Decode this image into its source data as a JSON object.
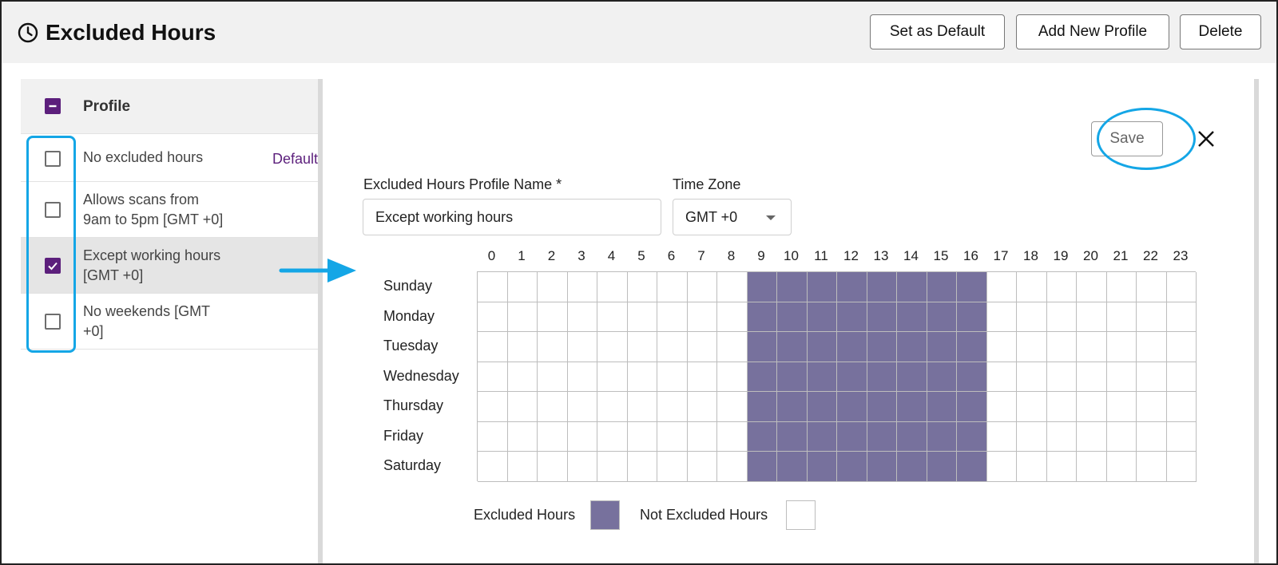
{
  "header": {
    "title": "Excluded Hours",
    "clock_icon": "clock-icon",
    "buttons": {
      "set_default": "Set as Default",
      "add_profile": "Add New Profile",
      "delete": "Delete"
    }
  },
  "profile_list": {
    "header_label": "Profile",
    "header_checkbox_state": "indeterminate",
    "items": [
      {
        "label_line1": "No excluded hours",
        "label_line2": "",
        "default_tag": "Default",
        "checked": false,
        "selected": false
      },
      {
        "label_line1": "Allows scans from",
        "label_line2": "9am to 5pm [GMT +0]",
        "default_tag": "",
        "checked": false,
        "selected": false
      },
      {
        "label_line1": "Except working hours",
        "label_line2": "[GMT +0]",
        "default_tag": "",
        "checked": true,
        "selected": true
      },
      {
        "label_line1": "No weekends [GMT",
        "label_line2": "+0]",
        "default_tag": "",
        "checked": false,
        "selected": false
      }
    ]
  },
  "editor": {
    "save_label": "Save",
    "close_icon": "close-icon",
    "profile_name_label": "Excluded Hours Profile Name *",
    "profile_name_value": "Except working hours",
    "time_zone_label": "Time Zone",
    "time_zone_value": "GMT +0"
  },
  "schedule": {
    "hours": [
      "0",
      "1",
      "2",
      "3",
      "4",
      "5",
      "6",
      "7",
      "8",
      "9",
      "10",
      "11",
      "12",
      "13",
      "14",
      "15",
      "16",
      "17",
      "18",
      "19",
      "20",
      "21",
      "22",
      "23"
    ],
    "days": [
      "Sunday",
      "Monday",
      "Tuesday",
      "Wednesday",
      "Thursday",
      "Friday",
      "Saturday"
    ],
    "excluded_hours_by_day": {
      "Sunday": [
        9,
        10,
        11,
        12,
        13,
        14,
        15,
        16
      ],
      "Monday": [
        9,
        10,
        11,
        12,
        13,
        14,
        15,
        16
      ],
      "Tuesday": [
        9,
        10,
        11,
        12,
        13,
        14,
        15,
        16
      ],
      "Wednesday": [
        9,
        10,
        11,
        12,
        13,
        14,
        15,
        16
      ],
      "Thursday": [
        9,
        10,
        11,
        12,
        13,
        14,
        15,
        16
      ],
      "Friday": [
        9,
        10,
        11,
        12,
        13,
        14,
        15,
        16
      ],
      "Saturday": [
        9,
        10,
        11,
        12,
        13,
        14,
        15,
        16
      ]
    },
    "legend": {
      "excluded_label": "Excluded Hours",
      "not_excluded_label": "Not Excluded Hours"
    }
  },
  "colors": {
    "accent_purple": "#5c1f7c",
    "excluded_cell": "#77719d",
    "callout_blue": "#14a6e6",
    "header_bg": "#f1f1f1"
  }
}
